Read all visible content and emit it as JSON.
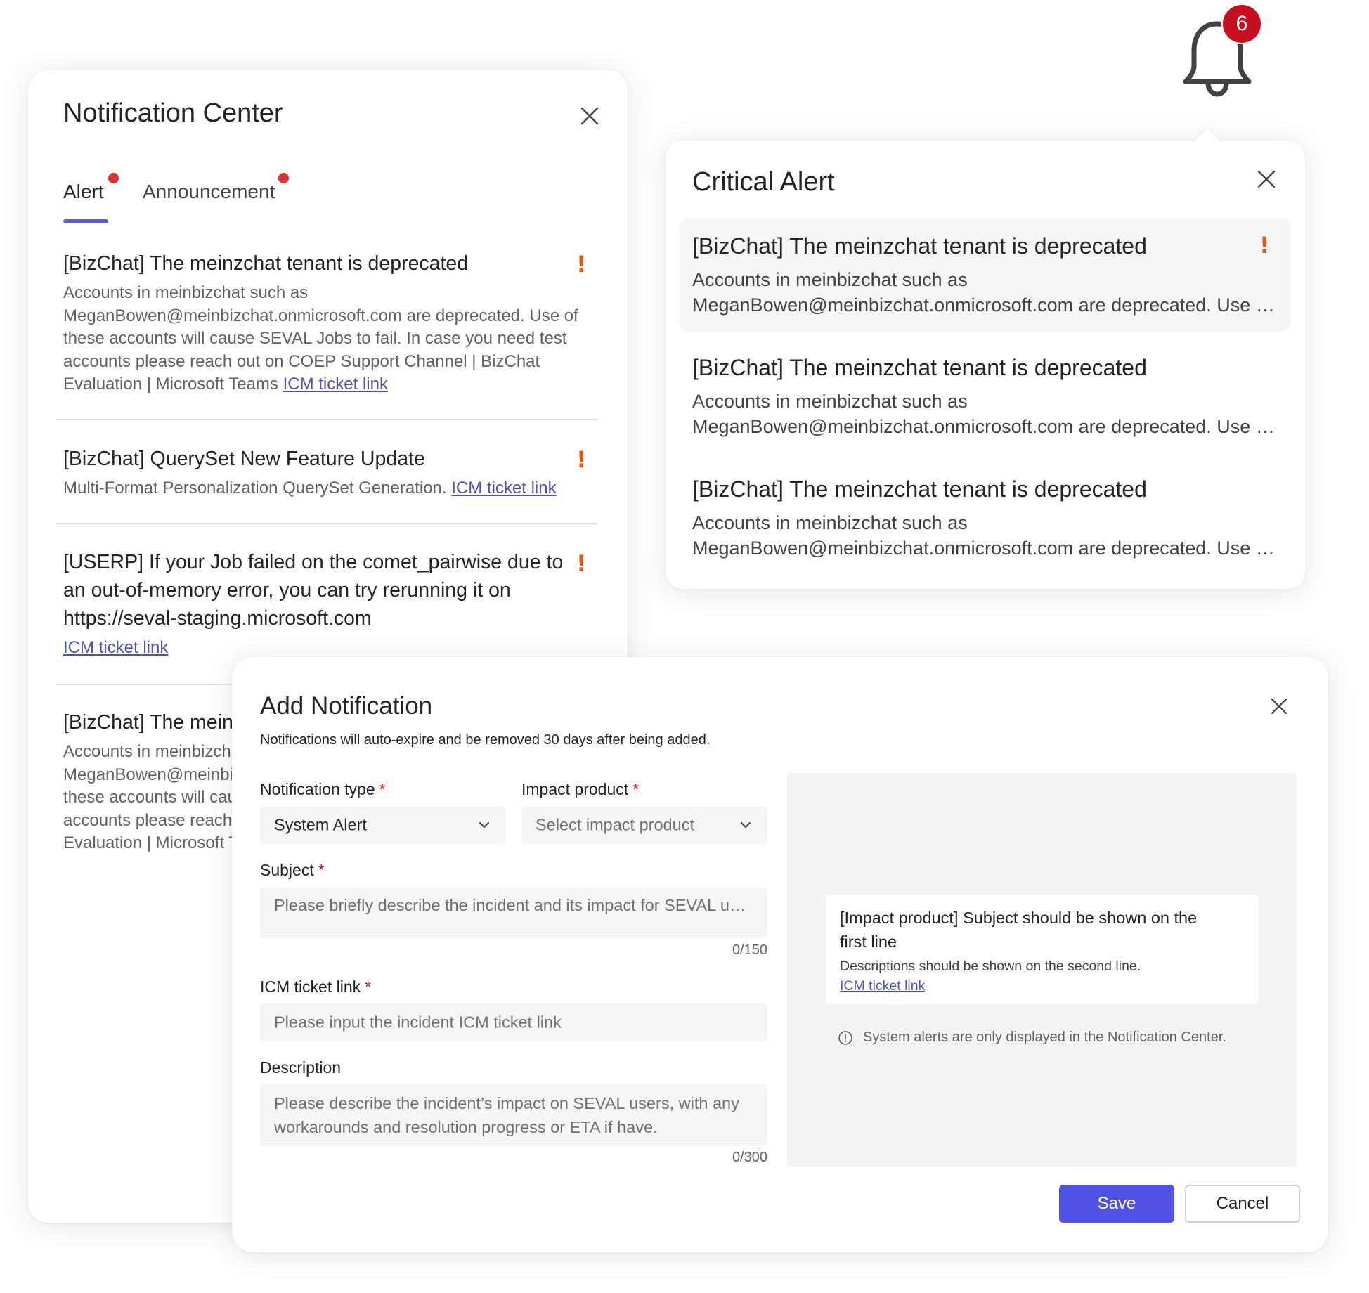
{
  "notification_center": {
    "title": "Notification Center",
    "tabs": [
      {
        "label": "Alert",
        "has_dot": true,
        "selected": true
      },
      {
        "label": "Announcement",
        "has_dot": true,
        "selected": false
      }
    ],
    "items": [
      {
        "subject": "[BizChat] The meinzchat tenant is deprecated",
        "description": "Accounts in meinbizchat such as MeganBowen@meinbizchat.onmicrosoft.com are deprecated. Use of these accounts will cause SEVAL Jobs to fail. In case you need test accounts please reach out on COEP Support Channel | BizChat Evaluation | Microsoft Teams",
        "link": "ICM ticket link"
      },
      {
        "subject": "[BizChat] QuerySet New Feature Update",
        "description": "Multi-Format Personalization QuerySet Generation.",
        "link": "ICM ticket link"
      },
      {
        "subject": "[USERP] If your Job failed on the comet_pairwise due to an out-of-memory error, you can try rerunning it on https://seval-staging.microsoft.com",
        "description": "",
        "link": "ICM ticket link"
      },
      {
        "subject": "[BizChat] The meinzchat tenant is deprecated",
        "description": "Accounts in meinbizchat such as MeganBowen@meinbizchat.onmicrosoft.com are deprecated. Use of these accounts will cause SEVAL Jobs to fail. In case you need test accounts please reach out on COEP Support Channel | BizChat Evaluation | Microsoft Teams",
        "link": ""
      }
    ]
  },
  "bell": {
    "badge_count": "6",
    "badge_color": "#c50f1f"
  },
  "critical_alert": {
    "title": "Critical Alert",
    "items": [
      {
        "subject": "[BizChat] The meinzchat tenant is deprecated",
        "line1": "Accounts in meinbizchat such as",
        "line2": "MeganBowen@meinbizchat.onmicrosoft.com are deprecated. Use of these accounts will cause SEVAL Jobs to fail."
      },
      {
        "subject": "[BizChat] The meinzchat tenant is deprecated",
        "line1": "Accounts in meinbizchat such as",
        "line2": "MeganBowen@meinbizchat.onmicrosoft.com are deprecated. Use of these accounts will cause SEVAL Jobs to fail."
      },
      {
        "subject": "[BizChat] The meinzchat tenant is deprecated",
        "line1": "Accounts in meinbizchat such as",
        "line2": "MeganBowen@meinbizchat.onmicrosoft.com are deprecated. Use of these accounts will cause SEVAL Jobs to fail."
      }
    ]
  },
  "add_notification": {
    "title": "Add Notification",
    "subtitle": "Notifications will auto-expire and be removed 30 days after being added.",
    "notification_type": {
      "label": "Notification type",
      "value": "System Alert"
    },
    "impact_product": {
      "label": "Impact product",
      "placeholder": "Select impact product"
    },
    "subject": {
      "label": "Subject",
      "placeholder": "Please briefly describe the incident and its impact for SEVAL users",
      "counter": "0/150"
    },
    "icm_link": {
      "label": "ICM ticket link",
      "placeholder": "Please input the incident ICM ticket link"
    },
    "description": {
      "label": "Description",
      "placeholder": "Please describe the incident’s impact on SEVAL users, with any workarounds and resolution progress or ETA if have.",
      "counter": "0/300"
    },
    "required_mark": "*",
    "preview": {
      "subject": "[Impact product] Subject should be shown on the first line",
      "description": "Descriptions should be shown on the second line.",
      "link": "ICM ticket link",
      "info": "System alerts are only displayed in the Notification Center."
    },
    "save_label": "Save",
    "cancel_label": "Cancel",
    "accent_color": "#4f52e3"
  },
  "alert_icon_color": "#d85b17"
}
